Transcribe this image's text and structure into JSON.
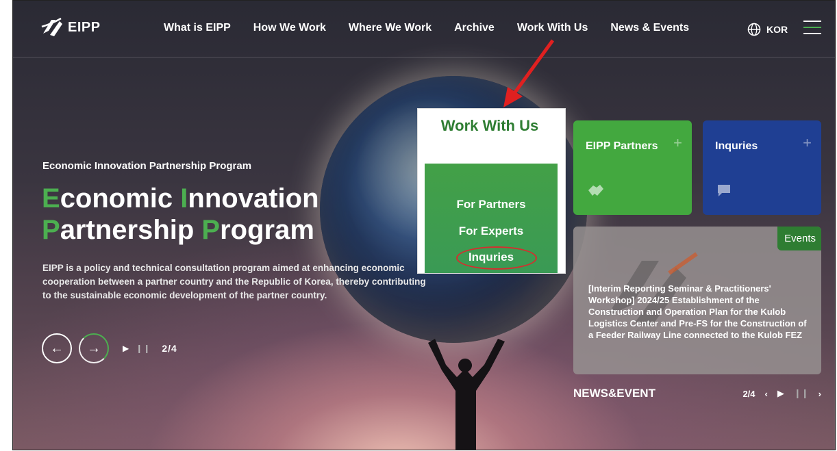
{
  "brand": {
    "name": "EIPP"
  },
  "nav": {
    "items": [
      "What is EIPP",
      "How We Work",
      "Where We Work",
      "Archive",
      "Work With Us",
      "News & Events"
    ],
    "language": "KOR"
  },
  "hero": {
    "eyebrow": "Economic Innovation Partnership Program",
    "title_line1": {
      "c1": "E",
      "w1": "conomic ",
      "c2": "I",
      "w2": "nnovation"
    },
    "title_line2": {
      "c1": "P",
      "w1": "artnership ",
      "c2": "P",
      "w2": "rogram"
    },
    "description": "EIPP is a policy and technical consultation program aimed at enhancing economic cooperation between a partner country and the Republic of Korea, thereby contributing to the sustainable economic development of the partner country.",
    "slide_counter": "2/4"
  },
  "dropdown": {
    "title": "Work With Us",
    "items": [
      "For Partners",
      "For Experts",
      "Inquries"
    ],
    "highlighted": "Inquries"
  },
  "cards": {
    "partners_title": "EIPP Partners",
    "inquiries_title": "Inquries"
  },
  "event": {
    "badge": "Events",
    "title": "[Interim Reporting Seminar & Practitioners' Workshop] 2024/25 Establishment of the Construction and Operation Plan for the Kulob Logistics Center and Pre-FS for the Construction of a Feeder Railway Line connected to the Kulob FEZ"
  },
  "news": {
    "label": "NEWS&EVENT",
    "counter": "2/4"
  },
  "colors": {
    "accent_green": "#43a83f",
    "accent_blue": "#1f3f93",
    "highlight_red": "#d32f2f"
  }
}
